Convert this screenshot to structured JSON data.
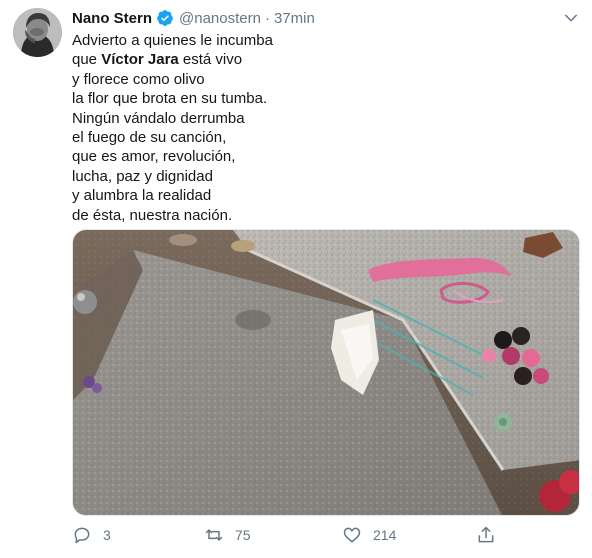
{
  "tweet": {
    "display_name": "Nano Stern",
    "verified": true,
    "handle": "@nanostern",
    "separator": "·",
    "time": "37min",
    "avatar_icon": "user-avatar-photo",
    "caret_icon": "chevron-down-icon",
    "lines": [
      {
        "pre": "Advierto a quienes le incumba",
        "bold": "",
        "post": ""
      },
      {
        "pre": "que ",
        "bold": "Víctor Jara",
        "post": " está vivo"
      },
      {
        "pre": "y florece como olivo",
        "bold": "",
        "post": ""
      },
      {
        "pre": "la flor que brota en su tumba.",
        "bold": "",
        "post": ""
      },
      {
        "pre": "Ningún vándalo derrumba",
        "bold": "",
        "post": ""
      },
      {
        "pre": "el fuego de su canción,",
        "bold": "",
        "post": ""
      },
      {
        "pre": "que es amor, revolución,",
        "bold": "",
        "post": ""
      },
      {
        "pre": "lucha, paz y dignidad",
        "bold": "",
        "post": ""
      },
      {
        "pre": "y alumbra la realidad",
        "bold": "",
        "post": ""
      },
      {
        "pre": "de ésta, nuestra nación.",
        "bold": "",
        "post": ""
      }
    ],
    "media_description_icon": "tomb-photo",
    "actions": {
      "reply_count": "3",
      "retweet_count": "75",
      "like_count": "214",
      "share_count": ""
    }
  },
  "colors": {
    "accent": "#1da1f2",
    "text": "#14171a",
    "muted": "#657786",
    "border": "#e1e8ed"
  }
}
